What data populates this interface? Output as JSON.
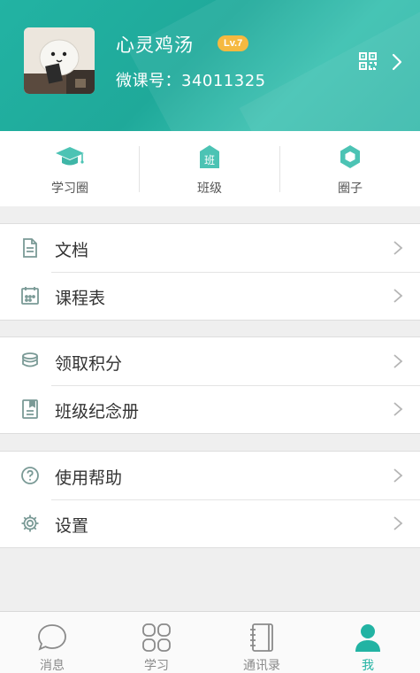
{
  "profile": {
    "nickname": "心灵鸡汤",
    "level": "Lv.7",
    "weike_prefix": "微课号：",
    "weike_id": "34011325"
  },
  "quick_nav": [
    {
      "label": "学习圈",
      "icon": "graduation-cap-icon"
    },
    {
      "label": "班级",
      "icon": "class-badge-icon",
      "badge_text": "班"
    },
    {
      "label": "圈子",
      "icon": "hexagon-icon"
    }
  ],
  "menu": {
    "group1": [
      {
        "label": "文档",
        "icon": "document-icon"
      },
      {
        "label": "课程表",
        "icon": "calendar-icon"
      }
    ],
    "group2": [
      {
        "label": "领取积分",
        "icon": "coins-icon"
      },
      {
        "label": "班级纪念册",
        "icon": "album-icon"
      }
    ],
    "group3": [
      {
        "label": "使用帮助",
        "icon": "help-icon"
      },
      {
        "label": "设置",
        "icon": "gear-icon"
      }
    ]
  },
  "tabs": [
    {
      "label": "消息",
      "icon": "chat-bubble-icon"
    },
    {
      "label": "学习",
      "icon": "grid-icon"
    },
    {
      "label": "通讯录",
      "icon": "contacts-book-icon"
    },
    {
      "label": "我",
      "icon": "person-icon",
      "active": true
    }
  ],
  "colors": {
    "accent": "#22b3a3",
    "level_badge": "#f5b940",
    "icon_gray": "#7a9a96"
  }
}
